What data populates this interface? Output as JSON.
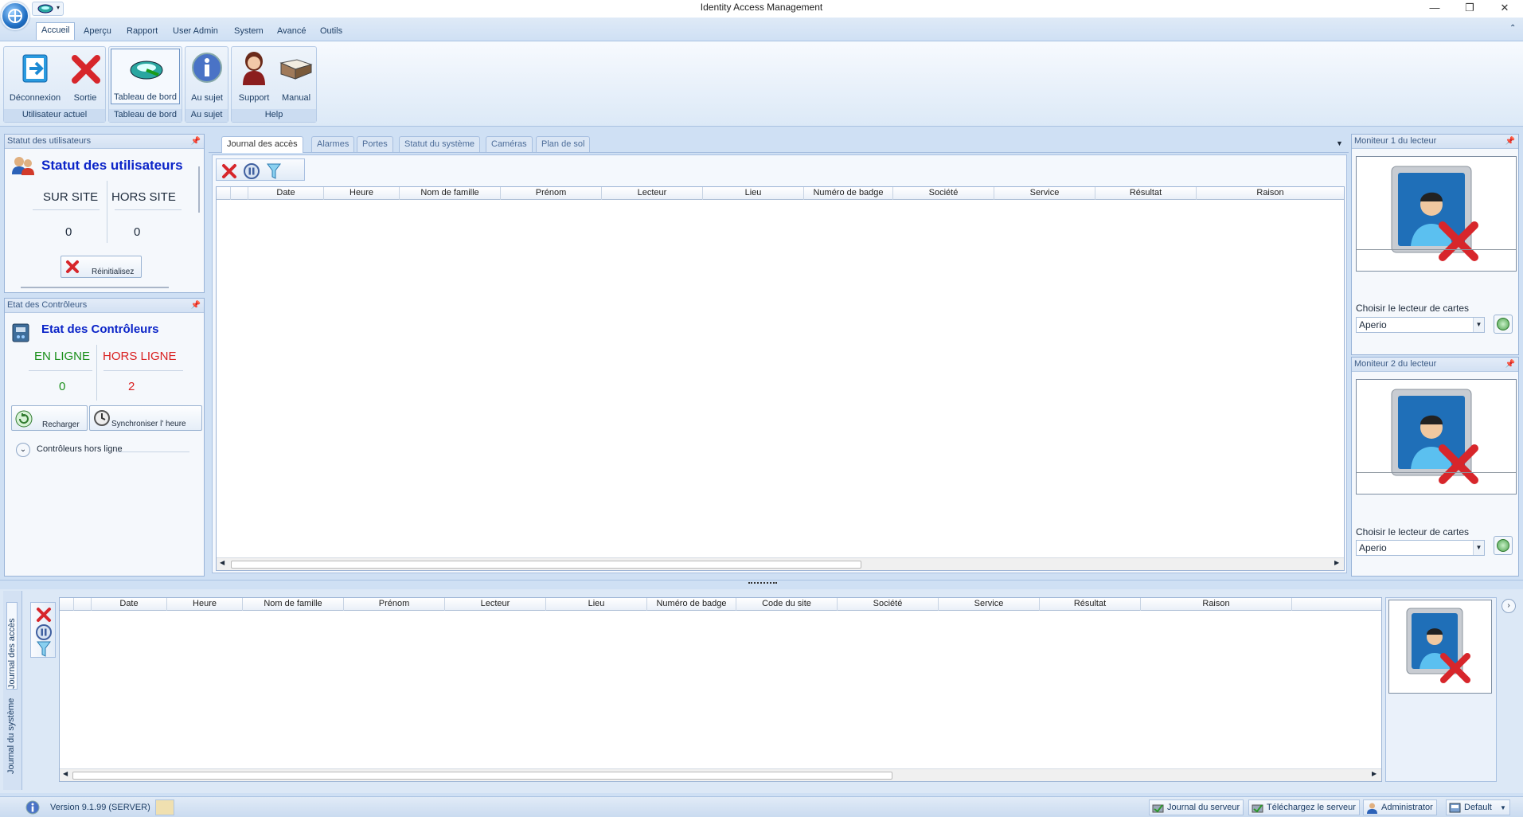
{
  "window": {
    "title": "Identity Access Management",
    "minimize": "—",
    "restore": "❐",
    "close": "✕"
  },
  "menu": {
    "tabs": [
      "Accueil",
      "Aperçu",
      "Rapport",
      "User Admin",
      "System",
      "Avancé",
      "Outils"
    ]
  },
  "ribbon": {
    "groups": {
      "current_user": "Utilisateur actuel",
      "dashboard": "Tableau de bord",
      "about": "Au sujet",
      "help": "Help"
    },
    "buttons": {
      "logout": "Déconnexion",
      "exit": "Sortie",
      "dashboard": "Tableau de bord",
      "about": "Au sujet",
      "support": "Support",
      "manual": "Manual"
    }
  },
  "user_status": {
    "panel_title": "Statut des utilisateurs",
    "title": "Statut des utilisateurs",
    "on_site_label": "SUR SITE",
    "off_site_label": "HORS SITE",
    "on_site": "0",
    "off_site": "0",
    "reset": "Réinitialisez"
  },
  "controllers": {
    "panel_title": "Etat des Contrôleurs",
    "title": "Etat des Contrôleurs",
    "online_label": "EN LIGNE",
    "offline_label": "HORS LIGNE",
    "online": "0",
    "offline": "2",
    "reload": "Recharger",
    "sync": "Synchroniser l' heure",
    "offline_list": "Contrôleurs hors ligne",
    "colors": {
      "online": "#1a8f1a",
      "offline": "#d91f1f"
    }
  },
  "center": {
    "tabs": [
      "Journal des accès",
      "Alarmes",
      "Portes",
      "Statut du système",
      "Caméras",
      "Plan de sol"
    ],
    "columns": [
      "Date",
      "Heure",
      "Nom de famille",
      "Prénom",
      "Lecteur",
      "Lieu",
      "Numéro de badge",
      "Société",
      "Service",
      "Résultat",
      "Raison"
    ]
  },
  "monitor1": {
    "title": "Moniteur 1 du lecteur",
    "choose": "Choisir le lecteur de cartes",
    "reader": "Aperio"
  },
  "monitor2": {
    "title": "Moniteur 2 du lecteur",
    "choose": "Choisir le lecteur de cartes",
    "reader": "Aperio"
  },
  "bottom": {
    "side_tabs": [
      "Journal des accès",
      "Journal du système"
    ],
    "columns": [
      "Date",
      "Heure",
      "Nom de famille",
      "Prénom",
      "Lecteur",
      "Lieu",
      "Numéro de badge",
      "Code du site",
      "Société",
      "Service",
      "Résultat",
      "Raison"
    ]
  },
  "statusbar": {
    "version": "Version 9.1.99  (SERVER)",
    "server_log": "Journal du serveur",
    "download": "Téléchargez le serveur",
    "user": "Administrator",
    "layout": "Default"
  }
}
